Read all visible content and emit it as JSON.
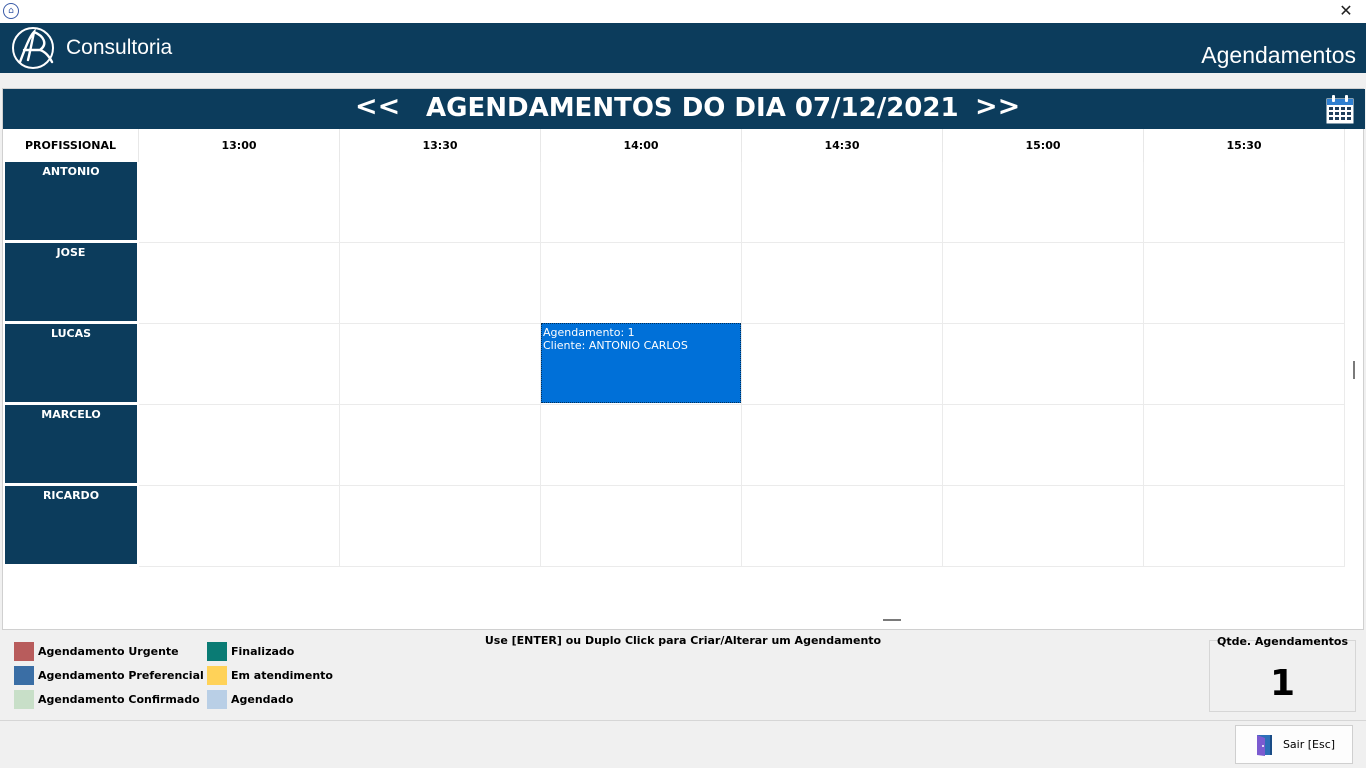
{
  "window": {
    "close_glyph": "✕"
  },
  "header": {
    "brand": "Consultoria",
    "module_title": "Agendamentos"
  },
  "nav": {
    "prev": "<<",
    "next": ">>",
    "title": "AGENDAMENTOS DO DIA 07/12/2021",
    "calendar_icon": "calendar-icon"
  },
  "grid": {
    "professional_header": "PROFISSIONAL",
    "time_slots": [
      "13:00",
      "13:30",
      "14:00",
      "14:30",
      "15:00",
      "15:30"
    ],
    "professionals": [
      "ANTONIO",
      "JOSE",
      "LUCAS",
      "MARCELO",
      "RICARDO"
    ]
  },
  "appointments": [
    {
      "professional": "LUCAS",
      "time": "14:00",
      "line1": "Agendamento: 1",
      "line2": "Cliente: ANTONIO CARLOS",
      "color": "#0070d8"
    }
  ],
  "legend": [
    {
      "label": "Agendamento Urgente",
      "color": "#b85c5c"
    },
    {
      "label": "Agendamento Preferencial",
      "color": "#3a6ea5"
    },
    {
      "label": "Agendamento Confirmado",
      "color": "#c8dfc8"
    },
    {
      "label": "Finalizado",
      "color": "#0a7b74"
    },
    {
      "label": "Em atendimento",
      "color": "#ffd258"
    },
    {
      "label": "Agendado",
      "color": "#b9cfe6"
    }
  ],
  "hint": "Use [ENTER] ou Duplo Click para Criar/Alterar um Agendamento",
  "counter": {
    "label": "Qtde. Agendamentos",
    "value": "1"
  },
  "exit_button": {
    "label": "Sair [Esc]"
  },
  "colors": {
    "header_bg": "#0c3c5c",
    "appointment": "#0070d8"
  }
}
